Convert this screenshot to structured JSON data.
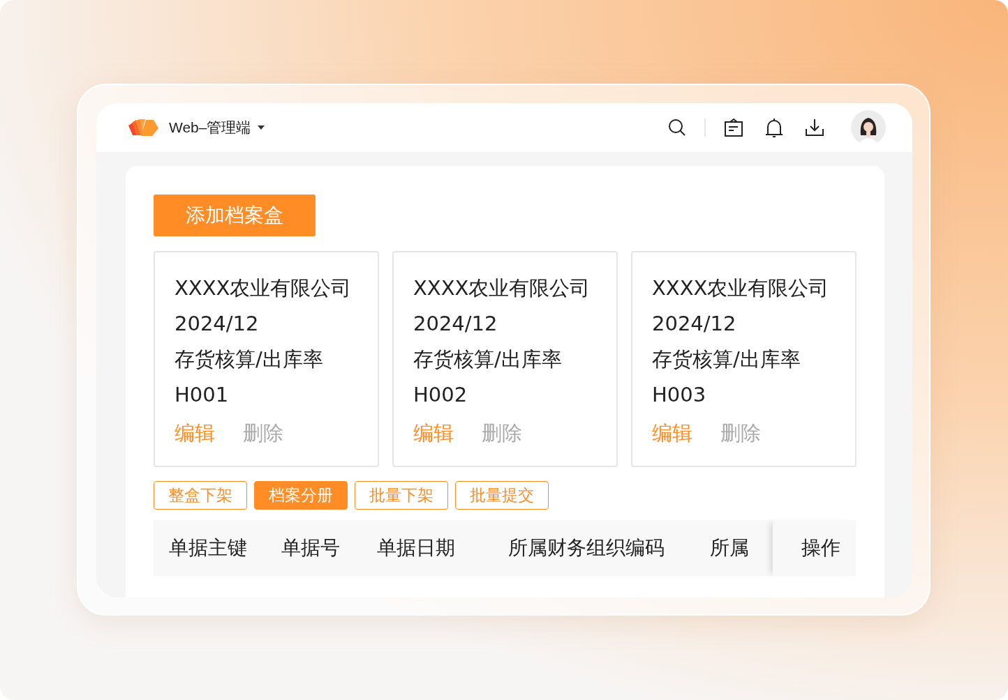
{
  "header": {
    "app_title": "Web–管理端"
  },
  "add_button": "添加档案盒",
  "archive_boxes": [
    {
      "company": "XXXX农业有限公司",
      "period": "2024/12",
      "category": "存货核算/出库率",
      "code": "H001",
      "actions": [
        {
          "label": "编辑",
          "kind": "edit"
        },
        {
          "label": "删除",
          "kind": "delete"
        }
      ]
    },
    {
      "company": "XXXX农业有限公司",
      "period": "2024/12",
      "category": "存货核算/出库率",
      "code": "H002",
      "actions": [
        {
          "label": "编辑",
          "kind": "edit"
        },
        {
          "label": "删除",
          "kind": "delete"
        }
      ]
    },
    {
      "company": "XXXX农业有限公司",
      "period": "2024/12",
      "category": "存货核算/出库率",
      "code": "H003",
      "actions": [
        {
          "label": "编辑",
          "kind": "edit"
        },
        {
          "label": "删除",
          "kind": "delete"
        }
      ]
    }
  ],
  "batch_buttons": [
    {
      "label": "整盒下架",
      "kind": "outline"
    },
    {
      "label": "档案分册",
      "kind": "filled"
    },
    {
      "label": "批量下架",
      "kind": "outline"
    },
    {
      "label": "批量提交",
      "kind": "outline"
    }
  ],
  "table": {
    "columns": [
      {
        "label": "单据主键",
        "fixed": false
      },
      {
        "label": "单据号",
        "fixed": false
      },
      {
        "label": "单据日期",
        "fixed": false
      },
      {
        "label": "所属财务组织编码",
        "fixed": false
      },
      {
        "label": "所属",
        "fixed": false
      },
      {
        "label": "操作",
        "fixed": true
      }
    ]
  }
}
